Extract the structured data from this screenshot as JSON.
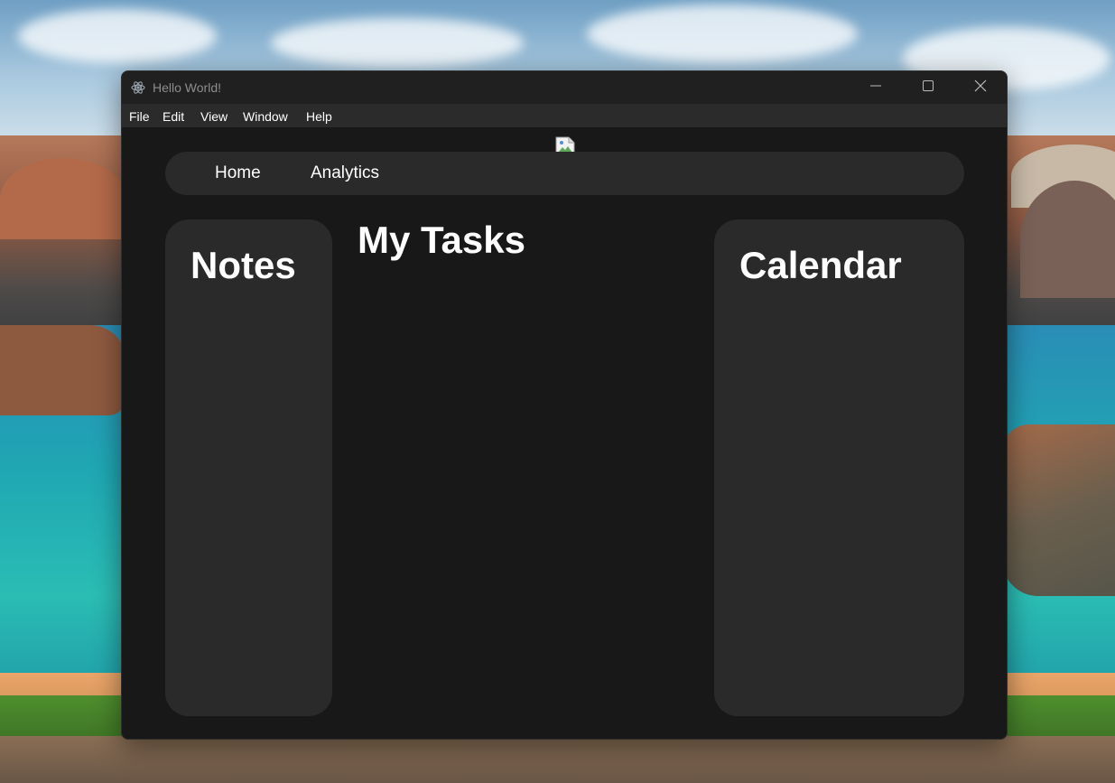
{
  "window": {
    "title": "Hello World!"
  },
  "menu": {
    "items": [
      "File",
      "Edit",
      "View",
      "Window",
      "Help"
    ]
  },
  "nav": {
    "links": [
      "Home",
      "Analytics"
    ]
  },
  "panels": {
    "notes_title": "Notes",
    "tasks_title": "My Tasks",
    "calendar_title": "Calendar"
  },
  "colors": {
    "window_bg": "#181818",
    "titlebar_bg": "#202020",
    "menubar_bg": "#2b2b2b",
    "panel_bg": "#2a2a2a",
    "text": "#ffffff",
    "title_text": "#8d8d8d"
  },
  "icons": {
    "app": "electron-atom-icon",
    "minimize": "minimize-icon",
    "maximize": "maximize-icon",
    "close": "close-icon",
    "broken_image": "broken-image-icon"
  }
}
